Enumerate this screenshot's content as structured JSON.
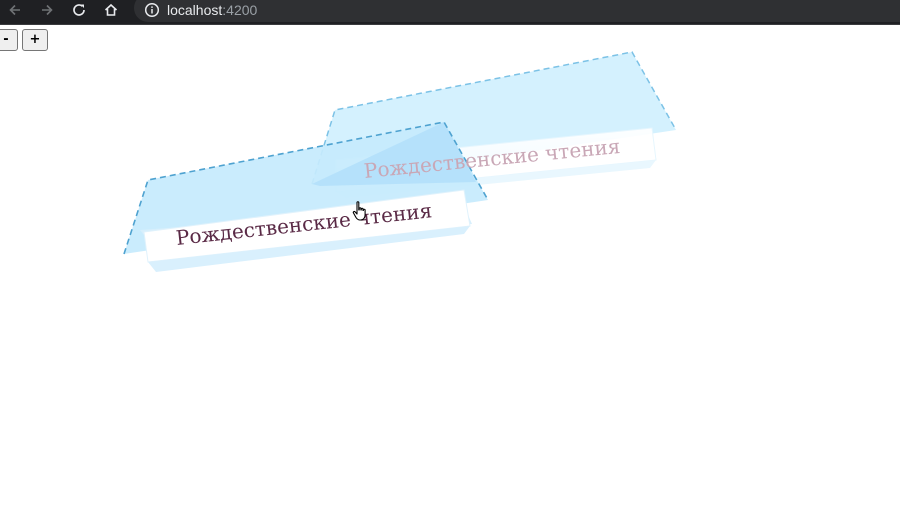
{
  "browser": {
    "url_host": "localhost",
    "url_port": ":4200",
    "icons": [
      "back-arrow-icon",
      "forward-arrow-icon",
      "reload-icon",
      "home-icon",
      "info-icon"
    ]
  },
  "controls": {
    "zoom_out_label": "-",
    "zoom_in_label": "+"
  },
  "ribbons": {
    "front_text": "Рождественские чтения",
    "back_text": "Рождественские чтения"
  },
  "colors": {
    "chrome_bg": "#1f2023",
    "omnibox_bg": "#2f3033",
    "panel_fill": "#cdeefe",
    "panel_border": "#5aa9d6",
    "front_text": "#5a2a46",
    "back_text": "#c9a7b6"
  }
}
